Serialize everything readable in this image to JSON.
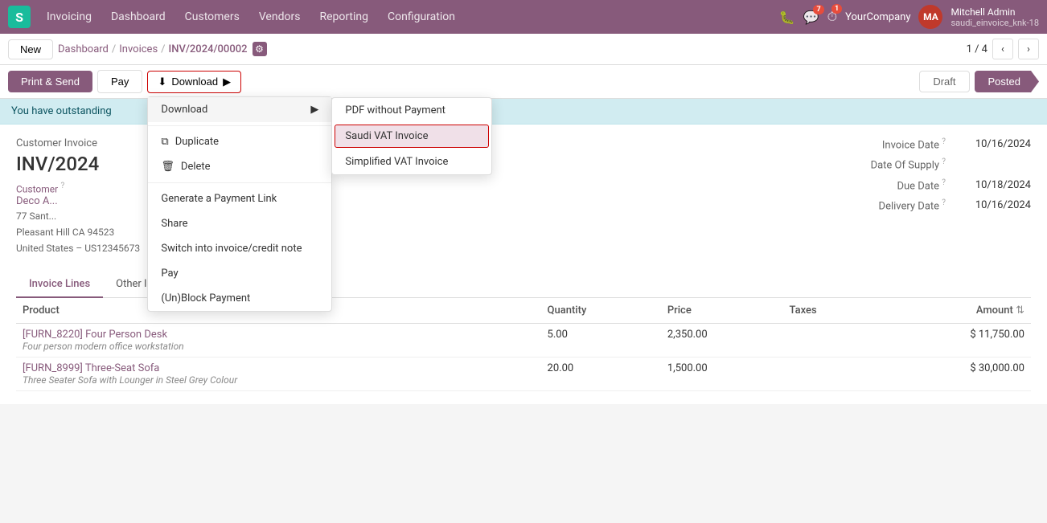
{
  "app": {
    "logo": "S",
    "name": "Invoicing"
  },
  "topnav": {
    "items": [
      {
        "label": "Dashboard",
        "active": false
      },
      {
        "label": "Customers",
        "active": false
      },
      {
        "label": "Vendors",
        "active": false
      },
      {
        "label": "Reporting",
        "active": false
      },
      {
        "label": "Configuration",
        "active": false
      }
    ],
    "icons": {
      "bug": "🐛",
      "chat_count": "7",
      "timer_count": "1"
    },
    "company": "YourCompany",
    "user": {
      "name": "Mitchell Admin",
      "sub": "saudi_einvoice_knk-18"
    }
  },
  "toolbar": {
    "new_label": "New",
    "breadcrumb": {
      "dashboard": "Dashboard",
      "invoices": "Invoices",
      "current": "INV/2024/00002"
    },
    "pagination": {
      "current": "1 / 4"
    }
  },
  "actionbar": {
    "print_send": "Print & Send",
    "pay": "Pay",
    "download": "Download",
    "download_icon": "⬇",
    "submenu_arrow": "▶",
    "status_draft": "Draft",
    "status_posted": "Posted"
  },
  "download_menu": {
    "items": [
      {
        "id": "pdf-no-payment",
        "label": "PDF without Payment",
        "highlighted": false
      },
      {
        "id": "saudi-vat",
        "label": "Saudi VAT Invoice",
        "highlighted": true
      },
      {
        "id": "simplified-vat",
        "label": "Simplified VAT Invoice",
        "highlighted": false
      }
    ]
  },
  "main_menu": {
    "items": [
      {
        "id": "duplicate",
        "label": "Duplicate",
        "icon": "⧉"
      },
      {
        "id": "delete",
        "label": "Delete",
        "icon": "🗑"
      }
    ],
    "section2": [
      {
        "id": "payment-link",
        "label": "Generate a Payment Link"
      },
      {
        "id": "share",
        "label": "Share"
      },
      {
        "id": "switch-invoice",
        "label": "Switch into invoice/credit note"
      },
      {
        "id": "pay",
        "label": "Pay"
      },
      {
        "id": "unblock",
        "label": "(Un)Block Payment"
      }
    ]
  },
  "outstanding": {
    "text": "You have outstanding"
  },
  "invoice": {
    "type": "Customer Invoice",
    "number": "INV/2024",
    "customer_label": "Customer",
    "customer_help": "?",
    "customer_name": "Deco A...",
    "address_line1": "77 Sant...",
    "address_line2": "Pleasant Hill CA 94523",
    "address_line3": "United States – US12345673",
    "invoice_date_label": "Invoice Date",
    "invoice_date_help": "?",
    "invoice_date": "10/16/2024",
    "date_of_supply_label": "Date Of Supply",
    "date_of_supply_help": "?",
    "date_of_supply": "",
    "due_date_label": "Due Date",
    "due_date_help": "?",
    "due_date": "10/18/2024",
    "delivery_date_label": "Delivery Date",
    "delivery_date_help": "?",
    "delivery_date": "10/16/2024"
  },
  "tabs": [
    {
      "id": "invoice-lines",
      "label": "Invoice Lines",
      "active": true
    },
    {
      "id": "other-info",
      "label": "Other Info",
      "active": false
    }
  ],
  "table": {
    "columns": [
      {
        "id": "product",
        "label": "Product"
      },
      {
        "id": "quantity",
        "label": "Quantity"
      },
      {
        "id": "price",
        "label": "Price"
      },
      {
        "id": "taxes",
        "label": "Taxes"
      },
      {
        "id": "amount",
        "label": "Amount"
      }
    ],
    "rows": [
      {
        "product_code": "FURN_8220",
        "product_name": "[FURN_8220] Four Person Desk",
        "product_desc": "Four person modern office workstation",
        "quantity": "5.00",
        "price": "2,350.00",
        "taxes": "",
        "amount": "$ 11,750.00"
      },
      {
        "product_code": "FURN_8999",
        "product_name": "[FURN_8999] Three-Seat Sofa",
        "product_desc": "Three Seater Sofa with Lounger in Steel Grey Colour",
        "quantity": "20.00",
        "price": "1,500.00",
        "taxes": "",
        "amount": "$ 30,000.00"
      }
    ]
  }
}
